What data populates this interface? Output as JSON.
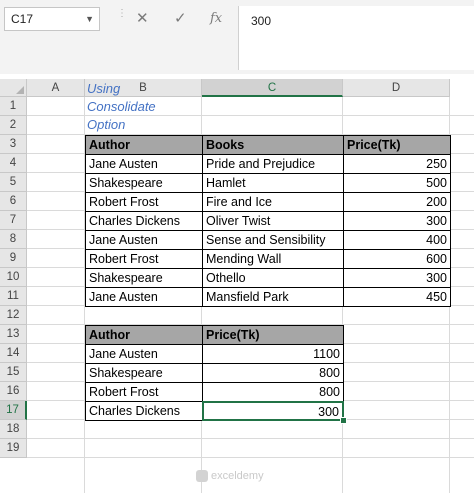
{
  "formula_bar": {
    "name_box": "C17",
    "cancel_icon": "✕",
    "enter_icon": "✓",
    "function_icon": "fx",
    "formula": "300"
  },
  "columns": [
    "A",
    "B",
    "C",
    "D"
  ],
  "rows": [
    "1",
    "2",
    "3",
    "4",
    "5",
    "6",
    "7",
    "8",
    "9",
    "10",
    "11",
    "12",
    "13",
    "14",
    "15",
    "16",
    "17",
    "18",
    "19"
  ],
  "selected": {
    "column": "C",
    "row": "17"
  },
  "sheet": {
    "title": "Using Consolidate Option",
    "table1": {
      "headers": [
        "Author",
        "Books",
        "Price(Tk)"
      ],
      "rows": [
        [
          "Jane Austen",
          "Pride and Prejudice",
          "250"
        ],
        [
          "Shakespeare",
          "Hamlet",
          "500"
        ],
        [
          "Robert Frost",
          "Fire and Ice",
          "200"
        ],
        [
          "Charles Dickens",
          "Oliver Twist",
          "300"
        ],
        [
          "Jane Austen",
          "Sense and Sensibility",
          "400"
        ],
        [
          "Robert Frost",
          "Mending Wall",
          "600"
        ],
        [
          "Shakespeare",
          "Othello",
          "300"
        ],
        [
          "Jane Austen",
          "Mansfield Park",
          "450"
        ]
      ]
    },
    "table2": {
      "headers": [
        "Author",
        "Price(Tk)"
      ],
      "rows": [
        [
          "Jane Austen",
          "1100"
        ],
        [
          "Shakespeare",
          "800"
        ],
        [
          "Robert Frost",
          "800"
        ],
        [
          "Charles Dickens",
          "300"
        ]
      ]
    }
  },
  "watermark": "exceldemy",
  "colors": {
    "header_fill": "#a6a6a6",
    "selection": "#217346",
    "title": "#4472c4"
  }
}
